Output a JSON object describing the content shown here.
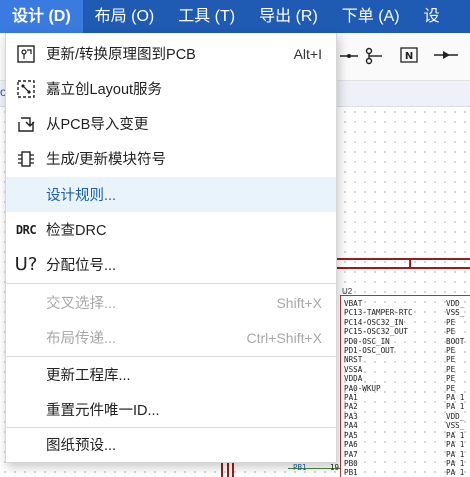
{
  "menubar": {
    "items": [
      {
        "label": "设计 (D)"
      },
      {
        "label": "布局 (O)"
      },
      {
        "label": "工具 (T)"
      },
      {
        "label": "导出 (R)"
      },
      {
        "label": "下单 (A)"
      },
      {
        "label": "设"
      }
    ]
  },
  "strip": {
    "text": "o"
  },
  "dropdown": {
    "items": [
      {
        "label": "更新/转换原理图到PCB",
        "shortcut": "Alt+I",
        "icon": "schematic-to-pcb-icon"
      },
      {
        "label": "嘉立创Layout服务",
        "shortcut": "",
        "icon": "layout-service-icon"
      },
      {
        "label": "从PCB导入变更",
        "shortcut": "",
        "icon": "import-changes-icon"
      },
      {
        "label": "生成/更新模块符号",
        "shortcut": "",
        "icon": "module-symbol-icon"
      },
      {
        "label": "设计规则...",
        "shortcut": "",
        "icon": ""
      },
      {
        "label": "检查DRC",
        "shortcut": "",
        "icon": "drc-icon"
      },
      {
        "label": "分配位号...",
        "shortcut": "",
        "icon": "annotate-icon"
      },
      {
        "label": "交叉选择...",
        "shortcut": "Shift+X",
        "icon": ""
      },
      {
        "label": "布局传递...",
        "shortcut": "Ctrl+Shift+X",
        "icon": ""
      },
      {
        "label": "更新工程库...",
        "shortcut": "",
        "icon": ""
      },
      {
        "label": "重置元件唯一ID...",
        "shortcut": "",
        "icon": ""
      },
      {
        "label": "图纸预设...",
        "shortcut": "",
        "icon": ""
      }
    ],
    "drc_icon_text": "DRC",
    "annotate_icon_text": "U?"
  },
  "schematic": {
    "ref": "U2",
    "pins_left": "VBAT\nPC13-TAMPER-RTC\nPC14-OSC32_IN\nPC15-OSC32_OUT\nPD0-OSC_IN\nPD1-OSC_OUT\nNRST\nVSSA\nVDDA\nPA0-WKUP\nPA1\nPA2\nPA3\nPA4\nPA5\nPA6\nPA7\nPB0\nPB1",
    "pins_right": "VDD_\nVSS_\nPE\nPE\nBOOT\nPE\nPE\nPE\nPE\nPE\nPA 1\nPA 1\nVDD_\nVSS_\nPA 1\nPA 1\nPA 1\nPA 1\nPA 1",
    "net_label": "PB1",
    "pin_number": "19"
  },
  "colors": {
    "menubar_bg": "#1f5bb3",
    "active_menu_bg": "#3b7be0",
    "hover_row_bg": "#e8f3fc",
    "hover_text": "#1a5fa8",
    "disabled_text": "#a8a8a8",
    "wire": "#9a1c1c"
  }
}
